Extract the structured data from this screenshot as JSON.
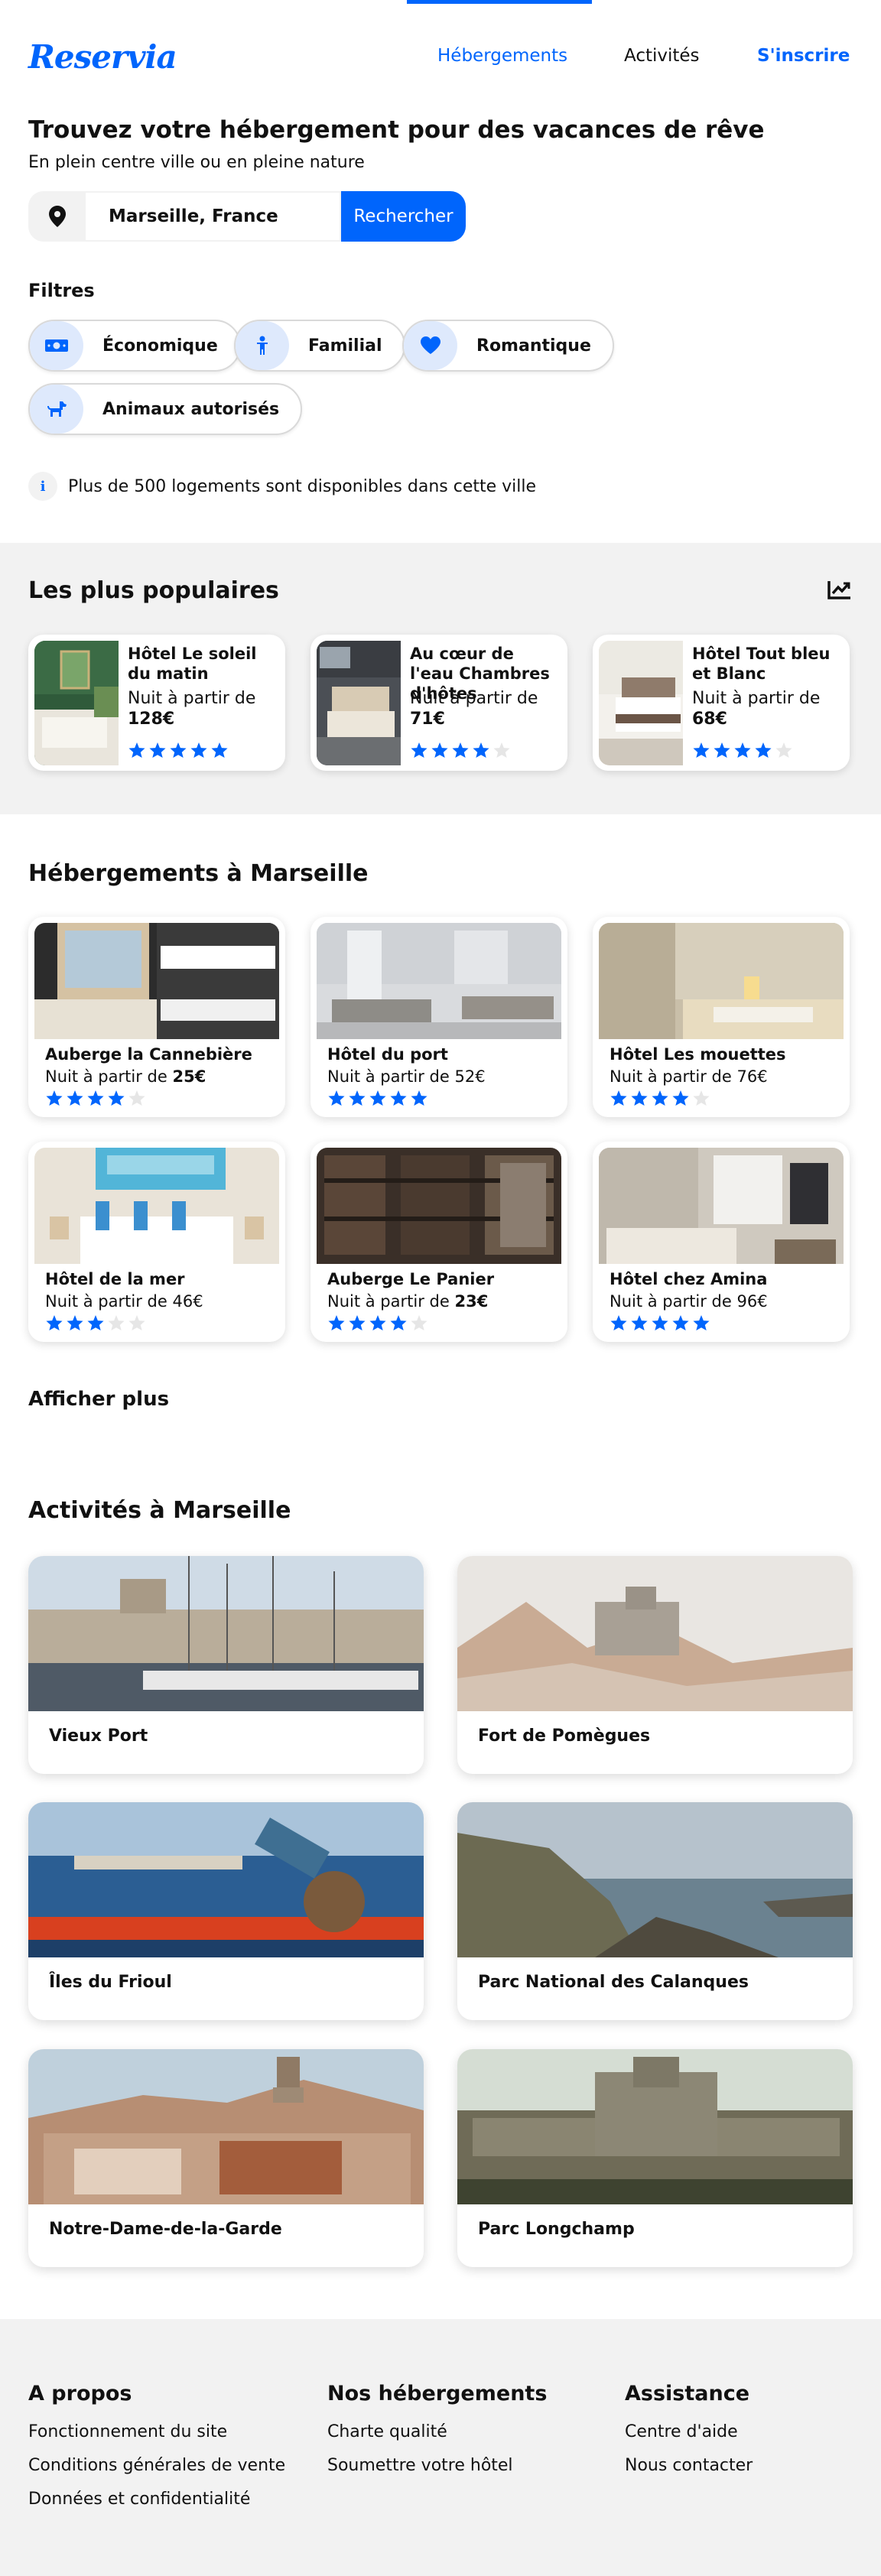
{
  "brand": {
    "logo": "Reservia",
    "accent": "#0065fc",
    "light_accent": "#dee9fc",
    "soft_bg": "#f2f2f2"
  },
  "nav": {
    "items": [
      "Hébergements",
      "Activités",
      "S'inscrire"
    ],
    "active": "Hébergements"
  },
  "hero": {
    "title": "Trouvez votre hébergement pour des vacances de rêve",
    "subtitle": "En plein centre ville ou en pleine nature",
    "search_value": "Marseille, France",
    "search_button": "Rechercher",
    "search_icon": "map-pin-icon"
  },
  "filters": {
    "title": "Filtres",
    "items": [
      {
        "label": "Économique",
        "icon": "money-icon"
      },
      {
        "label": "Familial",
        "icon": "child-icon"
      },
      {
        "label": "Romantique",
        "icon": "heart-icon"
      },
      {
        "label": "Animaux autorisés",
        "icon": "dog-icon"
      }
    ]
  },
  "info_text": "Plus de 500 logements sont disponibles dans cette ville",
  "popular": {
    "title": "Les plus populaires",
    "icon": "trending-up-icon",
    "items": [
      {
        "name": "Hôtel Le soleil du matin",
        "price_line1": "Nuit à partir de",
        "price_line2": "128€",
        "rating": 5
      },
      {
        "name": "Au cœur de l'eau Chambres d'hôtes",
        "price_line1": "Nuit à partir de",
        "price_line2": "71€",
        "rating": 4
      },
      {
        "name": "Hôtel Tout bleu et Blanc",
        "price_line1": "Nuit à partir de",
        "price_line2": "68€",
        "rating": 4
      }
    ]
  },
  "hotels": {
    "title": "Hébergements à Marseille",
    "price_prefix": "Nuit à partir de",
    "items": [
      {
        "name": "Auberge la Cannebière",
        "price": "25€",
        "rating": 4
      },
      {
        "name": "Hôtel du port",
        "price": "52€",
        "rating": 5
      },
      {
        "name": "Hôtel Les mouettes",
        "price": "76€",
        "rating": 4
      },
      {
        "name": "Hôtel de la mer",
        "price": "46€",
        "rating": 3
      },
      {
        "name": "Auberge Le Panier",
        "price": "23€",
        "rating": 4
      },
      {
        "name": "Hôtel chez Amina",
        "price": "96€",
        "rating": 5
      }
    ],
    "more": "Afficher plus"
  },
  "activities": {
    "title": "Activités à Marseille",
    "items": [
      {
        "name": "Vieux Port"
      },
      {
        "name": "Fort de Pomègues"
      },
      {
        "name": "Îles du Frioul"
      },
      {
        "name": "Parc National des Calanques"
      },
      {
        "name": "Notre-Dame-de-la-Garde"
      },
      {
        "name": "Parc Longchamp"
      }
    ]
  },
  "footer": {
    "columns": [
      {
        "title": "A propos",
        "links": [
          "Fonctionnement du site",
          "Conditions générales de vente",
          "Données et confidentialité"
        ]
      },
      {
        "title": "Nos hébergements",
        "links": [
          "Charte qualité",
          "Soumettre votre hôtel"
        ]
      },
      {
        "title": "Assistance",
        "links": [
          "Centre d'aide",
          "Nous contacter"
        ]
      }
    ]
  }
}
